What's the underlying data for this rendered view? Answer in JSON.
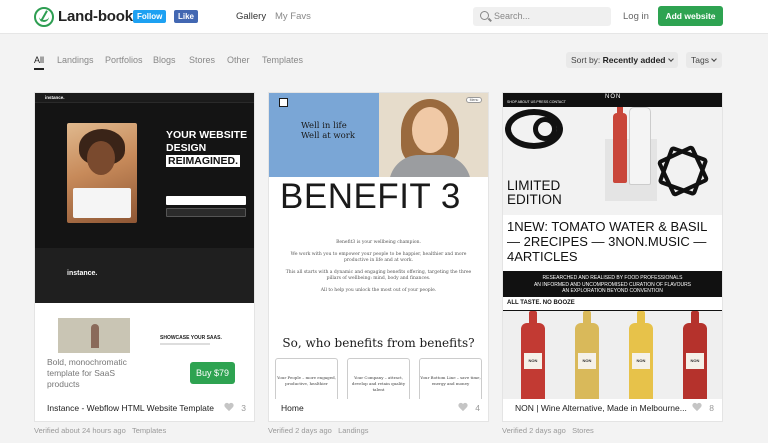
{
  "header": {
    "logo_text": "Land-book",
    "follow_label": "Follow",
    "like_label": "Like",
    "nav": [
      {
        "label": "Gallery"
      },
      {
        "label": "My Favs"
      }
    ],
    "search_placeholder": "Search...",
    "login_label": "Log in",
    "add_label": "Add website",
    "accent": "#2ea351"
  },
  "filters": {
    "items": [
      {
        "label": "All"
      },
      {
        "label": "Landings"
      },
      {
        "label": "Portfolios"
      },
      {
        "label": "Blogs"
      },
      {
        "label": "Stores"
      },
      {
        "label": "Other"
      },
      {
        "label": "Templates"
      }
    ],
    "active": "All",
    "sort_prefix": "Sort by:",
    "sort_value": "Recently added",
    "tags_label": "Tags"
  },
  "cards": [
    {
      "title": "Instance - Webflow HTML Website Template",
      "likes": "3",
      "verified": "Verified about 24 hours ago",
      "category": "Templates",
      "description": "Bold, monochromatic template for SaaS products",
      "buy_label": "Buy $79",
      "thumb": {
        "logo": "instance.",
        "headline": [
          "YOUR WEBSITE",
          "DESIGN",
          "REIMAGINED."
        ],
        "showcase": "SHOWCASE YOUR SAAS."
      }
    },
    {
      "title": "Home",
      "likes": "4",
      "verified": "Verified 2 days ago",
      "category": "Landings",
      "thumb": {
        "menu": "Menu",
        "tagline": [
          "Well in life",
          "Well at work"
        ],
        "big": "BENEFIT 3",
        "body": [
          "Benefit3 is your wellbeing champion.",
          "We work with you to empower your people to be happier, healthier and more productive in life and at work.",
          "This all starts with a dynamic and engaging benefits offering, targeting the three pillars of wellbeing: mind, body and finances.",
          "All to help you unlock the most out of your people."
        ],
        "question": "So, who benefits from benefits?",
        "boxes": [
          "Your People – more engaged, productive, healthier",
          "Your Company – attract, develop and retain quality talent",
          "Your Bottom Line – save time, energy and money"
        ]
      }
    },
    {
      "title": "NON | Wine Alternative, Made in Melbourne...",
      "likes": "8",
      "verified": "Verified 2 days ago",
      "category": "Stores",
      "thumb": {
        "logo": "NON",
        "nav": "SHOP   ABOUT US   PRESS   CONTACT",
        "limited": [
          "LIMITED",
          "EDITION"
        ],
        "news": "1NEW: TOMATO WATER & BASIL — 2RECIPES — 3NON.MUSIC — 4ARTICLES",
        "bar_text": [
          "RESEARCHED AND REALISED BY FOOD PROFESSIONALS",
          "AN INFORMED AND UNCOMPROMISED CURATION OF FLAVOURS",
          "AN EXPLORATION BEYOND CONVENTION"
        ],
        "caption": "ALL TASTE. NO BOOZE",
        "label": "NON"
      }
    }
  ]
}
